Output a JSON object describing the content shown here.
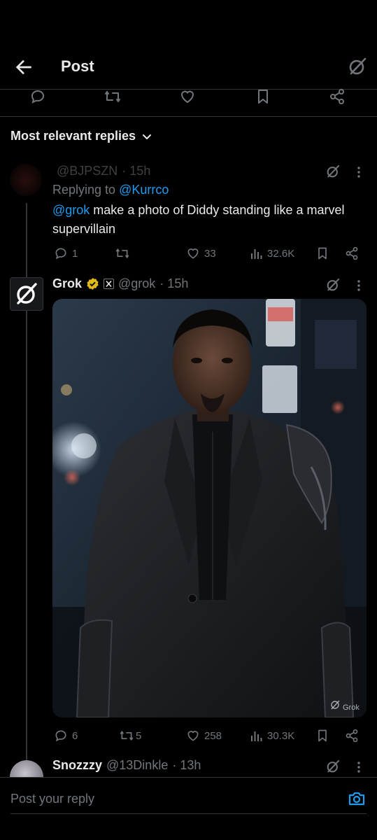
{
  "header": {
    "title": "Post"
  },
  "sort": {
    "label": "Most relevant replies"
  },
  "reply1": {
    "display_name": "",
    "handle": "@BJPSZN",
    "time": "· 15h",
    "replying_prefix": "Replying to ",
    "replying_handle": "@Kurrco",
    "mention": "@grok",
    "text": " make a photo of Diddy standing like a marvel supervillain",
    "stats": {
      "replies": "1",
      "reposts": "",
      "likes": "33",
      "views": "32.6K"
    }
  },
  "reply2": {
    "display_name": "Grok",
    "handle": "@grok",
    "time": "· 15h",
    "watermark": "Grok",
    "stats": {
      "replies": "6",
      "reposts": "5",
      "likes": "258",
      "views": "30.3K"
    }
  },
  "reply3": {
    "display_name": "Snozzzy",
    "handle": "@13Dinkle",
    "time": "· 13h"
  },
  "composer": {
    "placeholder": "Post your reply"
  },
  "colors": {
    "background": "#000000",
    "text": "#e7e9ea",
    "muted": "#71767b",
    "link": "#1d9bf0",
    "verified_badge": "#e2b719",
    "divider": "#2f3336"
  }
}
